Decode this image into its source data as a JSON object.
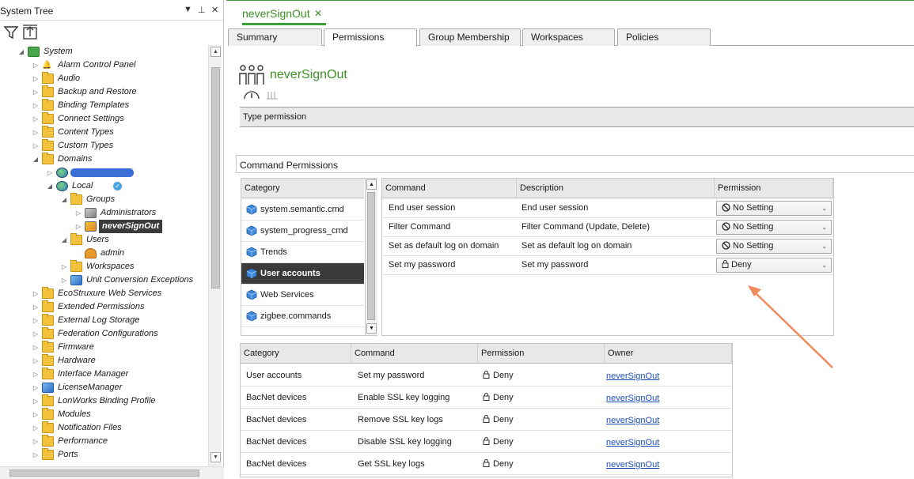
{
  "left_pane": {
    "title": "System Tree",
    "dropdown_glyph": "▼",
    "pin_glyph": "⊥",
    "close_glyph": "✕"
  },
  "tree": [
    {
      "label": "System",
      "depth": 0,
      "icon": "system-icon",
      "expander": "◢"
    },
    {
      "label": "Alarm Control Panel",
      "depth": 1,
      "icon": "bell-icon",
      "expander": "▷"
    },
    {
      "label": "Audio",
      "depth": 1,
      "icon": "folder-icon",
      "expander": "▷"
    },
    {
      "label": "Backup and Restore",
      "depth": 1,
      "icon": "folder-icon",
      "expander": "▷"
    },
    {
      "label": "Binding Templates",
      "depth": 1,
      "icon": "folder-icon",
      "expander": "▷"
    },
    {
      "label": "Connect Settings",
      "depth": 1,
      "icon": "folder-icon",
      "expander": "▷"
    },
    {
      "label": "Content Types",
      "depth": 1,
      "icon": "folder-icon",
      "expander": "▷"
    },
    {
      "label": "Custom Types",
      "depth": 1,
      "icon": "folder-icon",
      "expander": "▷"
    },
    {
      "label": "Domains",
      "depth": 1,
      "icon": "folder-icon",
      "expander": "◢"
    },
    {
      "label": "",
      "depth": 2,
      "icon": "globe-icon",
      "expander": "▷",
      "redacted": true
    },
    {
      "label": "Local",
      "depth": 2,
      "icon": "globe-icon",
      "expander": "◢",
      "verified": true
    },
    {
      "label": "Groups",
      "depth": 3,
      "icon": "folder-icon",
      "expander": "◢"
    },
    {
      "label": "Administrators",
      "depth": 4,
      "icon": "group-icon",
      "expander": "▷"
    },
    {
      "label": "neverSignOut",
      "depth": 4,
      "icon": "group-icon",
      "expander": "▷",
      "selected": true
    },
    {
      "label": "Users",
      "depth": 3,
      "icon": "users-folder-icon",
      "expander": "◢"
    },
    {
      "label": "admin",
      "depth": 4,
      "icon": "user-icon",
      "expander": ""
    },
    {
      "label": "Workspaces",
      "depth": 3,
      "icon": "folder-icon",
      "expander": "▷"
    },
    {
      "label": "Unit Conversion Exceptions",
      "depth": 3,
      "icon": "cube-icon",
      "expander": "▷"
    },
    {
      "label": "EcoStruxure Web Services",
      "depth": 1,
      "icon": "folder-icon",
      "expander": "▷"
    },
    {
      "label": "Extended Permissions",
      "depth": 1,
      "icon": "folder-icon",
      "expander": "▷"
    },
    {
      "label": "External Log Storage",
      "depth": 1,
      "icon": "folder-icon",
      "expander": "▷"
    },
    {
      "label": "Federation Configurations",
      "depth": 1,
      "icon": "folder-icon",
      "expander": "▷"
    },
    {
      "label": "Firmware",
      "depth": 1,
      "icon": "folder-icon",
      "expander": "▷"
    },
    {
      "label": "Hardware",
      "depth": 1,
      "icon": "folder-icon",
      "expander": "▷"
    },
    {
      "label": "Interface Manager",
      "depth": 1,
      "icon": "folder-icon",
      "expander": "▷"
    },
    {
      "label": "LicenseManager",
      "depth": 1,
      "icon": "cube-icon",
      "expander": "▷"
    },
    {
      "label": "LonWorks Binding Profile",
      "depth": 1,
      "icon": "folder-icon",
      "expander": "▷"
    },
    {
      "label": "Modules",
      "depth": 1,
      "icon": "folder-icon",
      "expander": "▷"
    },
    {
      "label": "Notification Files",
      "depth": 1,
      "icon": "folder-icon",
      "expander": "▷"
    },
    {
      "label": "Performance",
      "depth": 1,
      "icon": "folder-icon",
      "expander": "▷"
    },
    {
      "label": "Ports",
      "depth": 1,
      "icon": "folder-icon",
      "expander": "▷"
    }
  ],
  "document": {
    "tab_title": "neverSignOut",
    "close_glyph": "✕",
    "object_title": "neverSignOut",
    "tabs": [
      "Summary",
      "Permissions",
      "Group Membership",
      "Workspaces",
      "Policies"
    ],
    "active_tab": "Permissions"
  },
  "type_permission": {
    "label": "Type permission"
  },
  "command_permissions": {
    "section_label": "Command Permissions",
    "category_header": "Category",
    "categories": [
      {
        "label": "system.semantic.cmd"
      },
      {
        "label": "system_progress_cmd"
      },
      {
        "label": "Trends"
      },
      {
        "label": "User accounts",
        "selected": true
      },
      {
        "label": "Web Services"
      },
      {
        "label": "zigbee.commands"
      }
    ],
    "headers": {
      "command": "Command",
      "description": "Description",
      "permission": "Permission"
    },
    "rows": [
      {
        "command": "End user session",
        "description": "End user session",
        "permission": "No Setting",
        "perm_icon": "no-setting-icon"
      },
      {
        "command": "Filter Command",
        "description": "Filter Command (Update, Delete)",
        "permission": "No Setting",
        "perm_icon": "no-setting-icon"
      },
      {
        "command": "Set as default log on domain",
        "description": "Set as default log on domain",
        "permission": "No Setting",
        "perm_icon": "no-setting-icon"
      },
      {
        "command": "Set my password",
        "description": "Set my password",
        "permission": "Deny",
        "perm_icon": "lock-icon"
      }
    ]
  },
  "effective": {
    "headers": {
      "category": "Category",
      "command": "Command",
      "permission": "Permission",
      "owner": "Owner"
    },
    "rows": [
      {
        "category": "User accounts",
        "command": "Set my password",
        "permission": "Deny",
        "owner": "neverSignOut"
      },
      {
        "category": "BacNet devices",
        "command": "Enable SSL key logging",
        "permission": "Deny",
        "owner": "neverSignOut"
      },
      {
        "category": "BacNet devices",
        "command": "Remove SSL key logs",
        "permission": "Deny",
        "owner": "neverSignOut"
      },
      {
        "category": "BacNet devices",
        "command": "Disable SSL key logging",
        "permission": "Deny",
        "owner": "neverSignOut"
      },
      {
        "category": "BacNet devices",
        "command": "Get SSL key logs",
        "permission": "Deny",
        "owner": "neverSignOut"
      }
    ]
  },
  "colors": {
    "accent_green": "#3b8f23",
    "selection_dark": "#3b3b3b",
    "annotation_arrow": "#f08a5d",
    "link_blue": "#1a4fb8"
  }
}
